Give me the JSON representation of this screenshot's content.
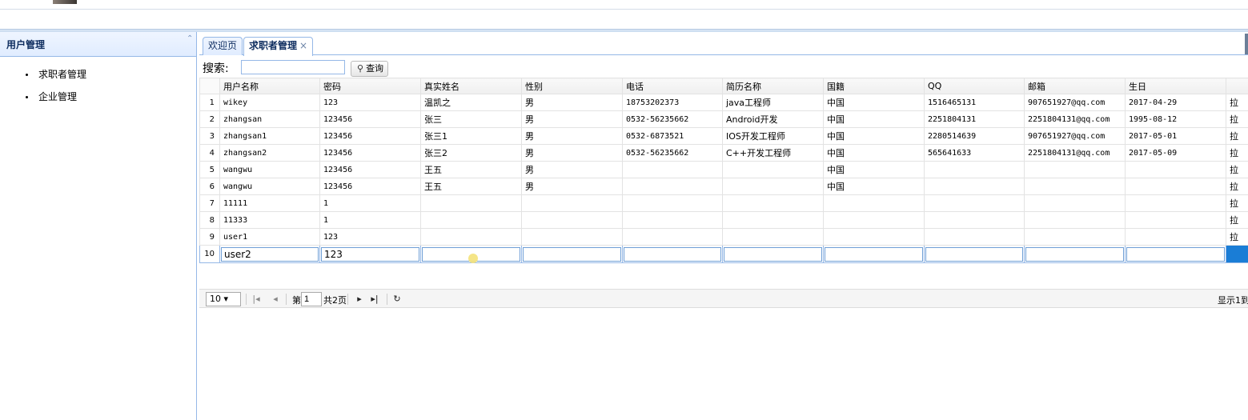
{
  "west": {
    "title": "用户管理",
    "collapse_icon": "double-chevron-up-icon",
    "items": [
      {
        "label": "求职者管理"
      },
      {
        "label": "企业管理"
      }
    ]
  },
  "tabs": [
    {
      "label": "欢迎页"
    },
    {
      "label": "求职者管理",
      "close": "×"
    }
  ],
  "toolbar": {
    "search_label": "搜索:",
    "search_value": "",
    "search_button": "查询",
    "search_icon": "magnifier-icon"
  },
  "grid": {
    "columns": [
      "用户名称",
      "密码",
      "真实姓名",
      "性别",
      "电话",
      "简历名称",
      "国籍",
      "QQ",
      "邮箱",
      "生日",
      ""
    ],
    "rows": [
      {
        "n": "1",
        "cells": [
          "wikey",
          "123",
          "温凯之",
          "男",
          "18753202373",
          "java工程师",
          "中国",
          "1516465131",
          "907651927@qq.com",
          "2017-04-29",
          "拉"
        ]
      },
      {
        "n": "2",
        "cells": [
          "zhangsan",
          "123456",
          "张三",
          "男",
          "0532-56235662",
          "Android开发",
          "中国",
          "2251804131",
          "2251804131@qq.com",
          "1995-08-12",
          "拉"
        ]
      },
      {
        "n": "3",
        "cells": [
          "zhangsan1",
          "123456",
          "张三1",
          "男",
          "0532-6873521",
          "IOS开发工程师",
          "中国",
          "2280514639",
          "907651927@qq.com",
          "2017-05-01",
          "拉"
        ]
      },
      {
        "n": "4",
        "cells": [
          "zhangsan2",
          "123456",
          "张三2",
          "男",
          "0532-56235662",
          "C++开发工程师",
          "中国",
          "565641633",
          "2251804131@qq.com",
          "2017-05-09",
          "拉"
        ]
      },
      {
        "n": "5",
        "cells": [
          "wangwu",
          "123456",
          "王五",
          "男",
          "",
          "",
          "中国",
          "",
          "",
          "",
          "拉"
        ]
      },
      {
        "n": "6",
        "cells": [
          "wangwu",
          "123456",
          "王五",
          "男",
          "",
          "",
          "中国",
          "",
          "",
          "",
          "拉"
        ]
      },
      {
        "n": "7",
        "cells": [
          "11111",
          "1",
          "",
          "",
          "",
          "",
          "",
          "",
          "",
          "",
          "拉"
        ]
      },
      {
        "n": "8",
        "cells": [
          "11333",
          "1",
          "",
          "",
          "",
          "",
          "",
          "",
          "",
          "",
          "拉"
        ]
      },
      {
        "n": "9",
        "cells": [
          "user1",
          "123",
          "",
          "",
          "",
          "",
          "",
          "",
          "",
          "",
          "拉"
        ]
      },
      {
        "n": "10",
        "cells": [
          "user2",
          "123",
          "",
          "",
          "",
          "",
          "",
          "",
          "",
          "",
          ""
        ]
      }
    ]
  },
  "pager": {
    "page_size": "10",
    "page_label": "第",
    "page_value": "1",
    "page_total": "共2页",
    "display_info": "显示1到"
  },
  "colors": {
    "accent": "#95b8e7",
    "header_bg": "#e0ecff",
    "selected": "#1a7dd6"
  }
}
